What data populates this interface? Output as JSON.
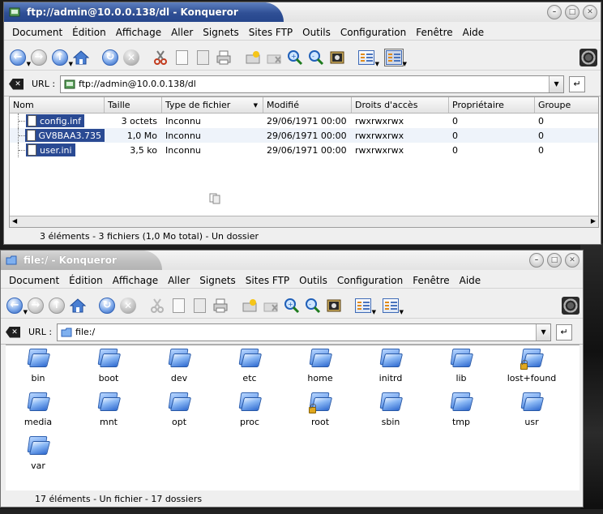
{
  "colors": {
    "active_title": "#2f4f95",
    "selection": "#2a4a93",
    "folder_blue": "#3c7ce0"
  },
  "menu": [
    "Document",
    "Édition",
    "Affichage",
    "Aller",
    "Signets",
    "Sites FTP",
    "Outils",
    "Configuration",
    "Fenêtre",
    "Aide"
  ],
  "window1": {
    "title": "ftp://admin@10.0.0.138/dl - Konqueror",
    "url_label": "URL :",
    "url_value": "ftp://admin@10.0.0.138/dl",
    "columns": [
      "Nom",
      "Taille",
      "Type de fichier",
      "Modifié",
      "Droits d'accès",
      "Propriétaire",
      "Groupe"
    ],
    "rows": [
      {
        "name": "config.inf",
        "size": "3 octets",
        "type": "Inconnu",
        "modified": "29/06/1971 00:00",
        "rights": "rwxrwxrwx",
        "owner": "0",
        "group": "0"
      },
      {
        "name": "GV8BAA3.735",
        "size": "1,0 Mo",
        "type": "Inconnu",
        "modified": "29/06/1971 00:00",
        "rights": "rwxrwxrwx",
        "owner": "0",
        "group": "0"
      },
      {
        "name": "user.ini",
        "size": "3,5 ko",
        "type": "Inconnu",
        "modified": "29/06/1971 00:00",
        "rights": "rwxrwxrwx",
        "owner": "0",
        "group": "0"
      }
    ],
    "status": "3 éléments - 3 fichiers (1,0 Mo total) - Un dossier"
  },
  "window2": {
    "title": "file:/ - Konqueror",
    "url_label": "URL :",
    "url_value": "file:/",
    "folders": [
      {
        "name": "bin",
        "locked": false
      },
      {
        "name": "boot",
        "locked": false
      },
      {
        "name": "dev",
        "locked": false
      },
      {
        "name": "etc",
        "locked": false
      },
      {
        "name": "home",
        "locked": false
      },
      {
        "name": "initrd",
        "locked": false
      },
      {
        "name": "lib",
        "locked": false
      },
      {
        "name": "lost+found",
        "locked": true
      },
      {
        "name": "media",
        "locked": false
      },
      {
        "name": "mnt",
        "locked": false
      },
      {
        "name": "opt",
        "locked": false
      },
      {
        "name": "proc",
        "locked": false
      },
      {
        "name": "root",
        "locked": true
      },
      {
        "name": "sbin",
        "locked": false
      },
      {
        "name": "tmp",
        "locked": false
      },
      {
        "name": "usr",
        "locked": false
      },
      {
        "name": "var",
        "locked": false
      }
    ],
    "status": "17 éléments - Un fichier - 17 dossiers"
  }
}
